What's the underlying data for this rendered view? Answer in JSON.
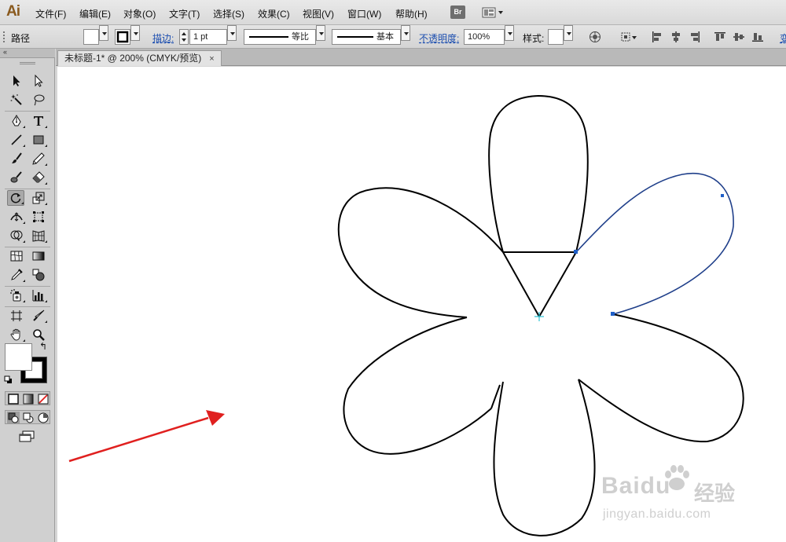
{
  "app": {
    "logo_text": "Ai"
  },
  "menu": [
    "文件(F)",
    "编辑(E)",
    "对象(O)",
    "文字(T)",
    "选择(S)",
    "效果(C)",
    "视图(V)",
    "窗口(W)",
    "帮助(H)"
  ],
  "menubar_buttons": {
    "bridge_label": "Br"
  },
  "control_bar": {
    "selection_label": "路径",
    "stroke_label": "描边:",
    "stroke_weight": "1 pt",
    "profile_label": "等比",
    "brush_label": "基本",
    "opacity_label": "不透明度:",
    "opacity_value": "100%",
    "style_label": "样式:",
    "overflow_label": "变"
  },
  "document_tab": {
    "title": "未标题-1* @ 200% (CMYK/预览)",
    "close_glyph": "×"
  },
  "toolbar": {
    "collapse_glyph": "«",
    "active_tool": "rotate-tool",
    "swap_glyph": "↰"
  },
  "colors": {
    "accent_arrow": "#e0201f",
    "selection_path": "#1f5fc8",
    "stroke": "#000000"
  },
  "watermark": {
    "brand": "Baidu",
    "suffix": "经验",
    "url": "jingyan.baidu.com"
  }
}
